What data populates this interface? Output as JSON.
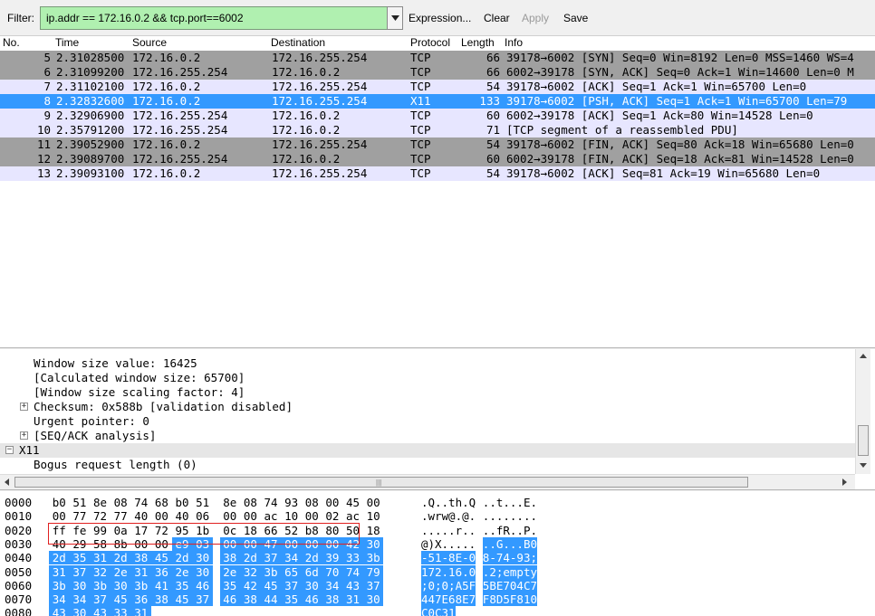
{
  "toolbar": {
    "filter_label": "Filter:",
    "filter_value": "ip.addr == 172.16.0.2 && tcp.port==6002",
    "expression_label": "Expression...",
    "clear_label": "Clear",
    "apply_label": "Apply",
    "save_label": "Save"
  },
  "packet_list": {
    "columns": [
      "No.",
      "Time",
      "Source",
      "Destination",
      "Protocol",
      "Length",
      "Info"
    ],
    "rows": [
      {
        "no": "5",
        "time": "2.31028500",
        "src": "172.16.0.2",
        "dst": "172.16.255.254",
        "proto": "TCP",
        "len": "66",
        "info": "39178→6002 [SYN] Seq=0 Win=8192 Len=0 MSS=1460 WS=4",
        "style": "gray"
      },
      {
        "no": "6",
        "time": "2.31099200",
        "src": "172.16.255.254",
        "dst": "172.16.0.2",
        "proto": "TCP",
        "len": "66",
        "info": "6002→39178 [SYN, ACK] Seq=0 Ack=1 Win=14600 Len=0 M",
        "style": "gray"
      },
      {
        "no": "7",
        "time": "2.31102100",
        "src": "172.16.0.2",
        "dst": "172.16.255.254",
        "proto": "TCP",
        "len": "54",
        "info": "39178→6002 [ACK] Seq=1 Ack=1 Win=65700 Len=0",
        "style": "light"
      },
      {
        "no": "8",
        "time": "2.32832600",
        "src": "172.16.0.2",
        "dst": "172.16.255.254",
        "proto": "X11",
        "len": "133",
        "info": "39178→6002 [PSH, ACK] Seq=1 Ack=1 Win=65700 Len=79",
        "style": "selected"
      },
      {
        "no": "9",
        "time": "2.32906900",
        "src": "172.16.255.254",
        "dst": "172.16.0.2",
        "proto": "TCP",
        "len": "60",
        "info": "6002→39178 [ACK] Seq=1 Ack=80 Win=14528 Len=0",
        "style": "light"
      },
      {
        "no": "10",
        "time": "2.35791200",
        "src": "172.16.255.254",
        "dst": "172.16.0.2",
        "proto": "TCP",
        "len": "71",
        "info": "[TCP segment of a reassembled PDU]",
        "style": "light"
      },
      {
        "no": "11",
        "time": "2.39052900",
        "src": "172.16.0.2",
        "dst": "172.16.255.254",
        "proto": "TCP",
        "len": "54",
        "info": "39178→6002 [FIN, ACK] Seq=80 Ack=18 Win=65680 Len=0",
        "style": "gray"
      },
      {
        "no": "12",
        "time": "2.39089700",
        "src": "172.16.255.254",
        "dst": "172.16.0.2",
        "proto": "TCP",
        "len": "60",
        "info": "6002→39178 [FIN, ACK] Seq=18 Ack=81 Win=14528 Len=0",
        "style": "gray"
      },
      {
        "no": "13",
        "time": "2.39093100",
        "src": "172.16.0.2",
        "dst": "172.16.255.254",
        "proto": "TCP",
        "len": "54",
        "info": "39178→6002 [ACK] Seq=81 Ack=19 Win=65680 Len=0",
        "style": "light"
      }
    ]
  },
  "details": {
    "rows": [
      {
        "text": "Window size value: 16425",
        "indent": 1,
        "expander": "none",
        "band": false
      },
      {
        "text": "[Calculated window size: 65700]",
        "indent": 1,
        "expander": "none",
        "band": false
      },
      {
        "text": "[Window size scaling factor: 4]",
        "indent": 1,
        "expander": "none",
        "band": false
      },
      {
        "text": "Checksum: 0x588b [validation disabled]",
        "indent": 1,
        "expander": "plus",
        "band": false
      },
      {
        "text": "Urgent pointer: 0",
        "indent": 1,
        "expander": "none",
        "band": false
      },
      {
        "text": "[SEQ/ACK analysis]",
        "indent": 1,
        "expander": "plus",
        "band": false
      },
      {
        "text": "X11",
        "indent": 0,
        "expander": "minus",
        "band": true
      },
      {
        "text": "Bogus request length (0)",
        "indent": 1,
        "expander": "none",
        "band": false
      }
    ]
  },
  "bytes": {
    "rows": [
      {
        "offset": "0000",
        "hex": [
          "b0",
          "51",
          "8e",
          "08",
          "74",
          "68",
          "b0",
          "51",
          "8e",
          "08",
          "74",
          "93",
          "08",
          "00",
          "45",
          "00"
        ],
        "ascii_a": ".Q..th.Q",
        "ascii_b": "..t...E.",
        "hl_from": 99,
        "ascii_hl_a": false,
        "ascii_hl_b": false
      },
      {
        "offset": "0010",
        "hex": [
          "00",
          "77",
          "72",
          "77",
          "40",
          "00",
          "40",
          "06",
          "00",
          "00",
          "ac",
          "10",
          "00",
          "02",
          "ac",
          "10"
        ],
        "ascii_a": ".wrw@.@.",
        "ascii_b": "........",
        "hl_from": 99,
        "ascii_hl_a": false,
        "ascii_hl_b": false
      },
      {
        "offset": "0020",
        "hex": [
          "ff",
          "fe",
          "99",
          "0a",
          "17",
          "72",
          "95",
          "1b",
          "0c",
          "18",
          "66",
          "52",
          "b8",
          "80",
          "50",
          "18"
        ],
        "ascii_a": ".....r..",
        "ascii_b": "..fR..P.",
        "hl_from": 99,
        "ascii_hl_a": false,
        "ascii_hl_b": false
      },
      {
        "offset": "0030",
        "hex": [
          "40",
          "29",
          "58",
          "8b",
          "00",
          "00",
          "e9",
          "03",
          "00",
          "00",
          "47",
          "00",
          "00",
          "00",
          "42",
          "30"
        ],
        "ascii_a": "@)X.....",
        "ascii_b": "..G...B0",
        "hl_from": 6,
        "ascii_hl_a": false,
        "ascii_hl_b": true
      },
      {
        "offset": "0040",
        "hex": [
          "2d",
          "35",
          "31",
          "2d",
          "38",
          "45",
          "2d",
          "30",
          "38",
          "2d",
          "37",
          "34",
          "2d",
          "39",
          "33",
          "3b"
        ],
        "ascii_a": "-51-8E-0",
        "ascii_b": "8-74-93;",
        "hl_from": 0,
        "ascii_hl_a": true,
        "ascii_hl_b": true
      },
      {
        "offset": "0050",
        "hex": [
          "31",
          "37",
          "32",
          "2e",
          "31",
          "36",
          "2e",
          "30",
          "2e",
          "32",
          "3b",
          "65",
          "6d",
          "70",
          "74",
          "79"
        ],
        "ascii_a": "172.16.0",
        "ascii_b": ".2;empty",
        "hl_from": 0,
        "ascii_hl_a": true,
        "ascii_hl_b": true
      },
      {
        "offset": "0060",
        "hex": [
          "3b",
          "30",
          "3b",
          "30",
          "3b",
          "41",
          "35",
          "46",
          "35",
          "42",
          "45",
          "37",
          "30",
          "34",
          "43",
          "37"
        ],
        "ascii_a": ";0;0;A5F",
        "ascii_b": "5BE704C7",
        "hl_from": 0,
        "ascii_hl_a": true,
        "ascii_hl_b": true
      },
      {
        "offset": "0070",
        "hex": [
          "34",
          "34",
          "37",
          "45",
          "36",
          "38",
          "45",
          "37",
          "46",
          "38",
          "44",
          "35",
          "46",
          "38",
          "31",
          "30"
        ],
        "ascii_a": "447E68E7",
        "ascii_b": "F8D5F810",
        "hl_from": 0,
        "ascii_hl_a": true,
        "ascii_hl_b": true
      },
      {
        "offset": "0080",
        "hex": [
          "43",
          "30",
          "43",
          "33",
          "31"
        ],
        "ascii_a": "C0C31",
        "ascii_b": "",
        "hl_from": 0,
        "ascii_hl_a": true,
        "ascii_hl_b": false
      }
    ]
  },
  "colors": {
    "row_gray": "#a0a0a0",
    "row_light": "#e7e6ff",
    "row_selected": "#3399ff",
    "filter_valid": "#b0f0b0",
    "byte_highlight": "#3399ff",
    "annotation_box": "#e02020"
  },
  "icons": [
    "chevron-down-icon",
    "expand-plus-icon",
    "collapse-minus-icon",
    "scroll-up-icon",
    "scroll-down-icon",
    "scroll-left-icon",
    "scroll-right-icon"
  ]
}
